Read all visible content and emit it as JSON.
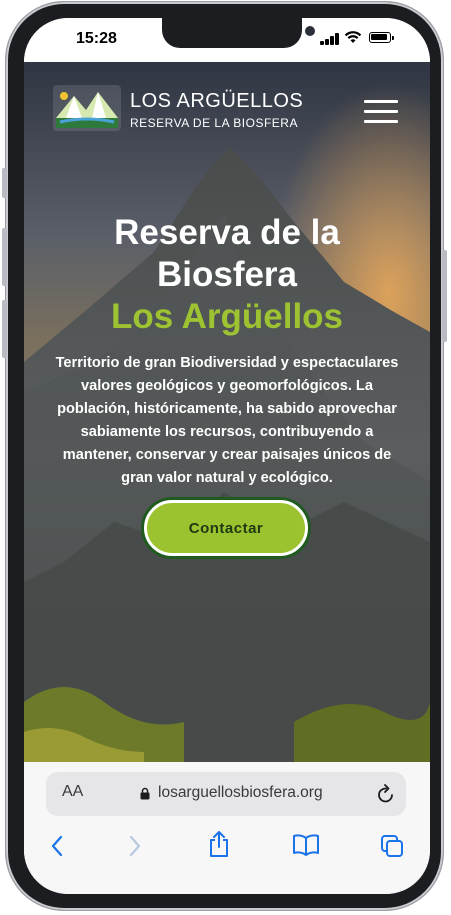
{
  "status_bar": {
    "time": "15:28"
  },
  "header": {
    "logo_line1": "LOS ARGÜELLOS",
    "logo_line2": "RESERVA DE LA BIOSFERA",
    "menu_icon": "hamburger-menu-icon"
  },
  "hero": {
    "title_line1": "Reserva de la",
    "title_line2": "Biosfera",
    "title_line3": "Los Argüellos",
    "description_lines": [
      "Territorio de gran Biodiversidad y espectaculares",
      "valores geológicos y geomorfológicos. La",
      "población, históricamente, ha sabido aprovechar",
      "sabiamente los recursos, contribuyendo a",
      "mantener, conservar y crear paisajes únicos de",
      "gran valor natural y ecológico."
    ],
    "cta_label": "Contactar"
  },
  "browser": {
    "text_size_label": "AA",
    "url": "losarguellosbiosfera.org",
    "icons": [
      "lock-icon",
      "reload-icon",
      "back-icon",
      "forward-icon",
      "share-icon",
      "bookmarks-icon",
      "tabs-icon"
    ]
  },
  "colors": {
    "accent_green": "#9dc232",
    "cta_border": "#1f5a1f",
    "ios_blue": "#1a73e8"
  }
}
